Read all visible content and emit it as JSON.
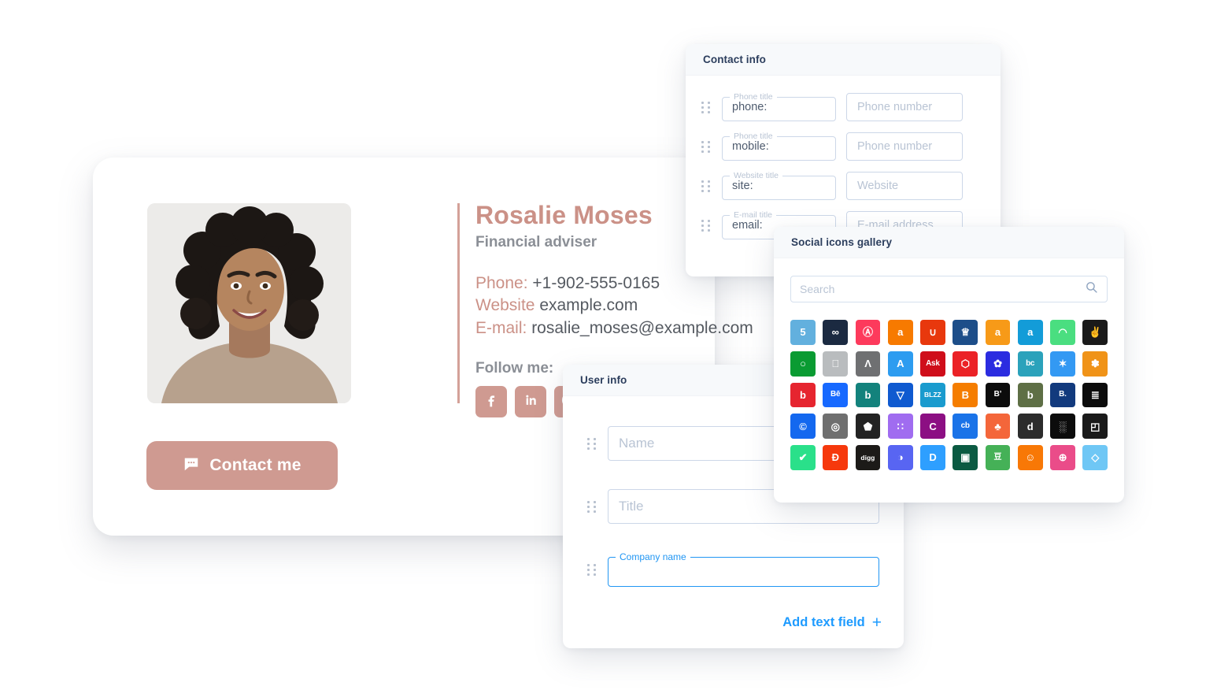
{
  "signature_card": {
    "name": "Rosalie Moses",
    "role": "Financial adviser",
    "contact_lines": [
      {
        "label": "Phone:",
        "value": "+1-902-555-0165"
      },
      {
        "label": "Website",
        "value": "example.com"
      },
      {
        "label": "E-mail:",
        "value": "rosalie_moses@example.com"
      }
    ],
    "follow_label": "Follow me:",
    "social_buttons": [
      {
        "name": "facebook-icon"
      },
      {
        "name": "linkedin-icon"
      },
      {
        "name": "messenger-icon"
      }
    ],
    "contact_button": {
      "label": "Contact me",
      "icon": "chat-bubble-icon"
    },
    "colors": {
      "accent": "#cb9187",
      "button": "#cf9a91",
      "role": "#8b8f96",
      "body_text": "#555a61"
    }
  },
  "contact_info_panel": {
    "title": "Contact info",
    "rows": [
      {
        "legend": "Phone title",
        "value": "phone:",
        "placeholder": "Phone number"
      },
      {
        "legend": "Phone title",
        "value": "mobile:",
        "placeholder": "Phone number"
      },
      {
        "legend": "Website title",
        "value": "site:",
        "placeholder": "Website"
      },
      {
        "legend": "E-mail title",
        "value": "email:",
        "placeholder": "E-mail address"
      }
    ]
  },
  "user_info_panel": {
    "title": "User info",
    "rows": [
      {
        "type": "placeholder",
        "placeholder": "Name",
        "legend": "",
        "value": ""
      },
      {
        "type": "placeholder",
        "placeholder": "Title",
        "legend": "",
        "value": ""
      },
      {
        "type": "outlined",
        "legend": "Company name",
        "value": "",
        "placeholder": "",
        "active": true
      }
    ],
    "add_field_label": "Add text field",
    "add_field_icon": "plus-icon",
    "colors": {
      "link": "#1e9bff"
    }
  },
  "gallery_panel": {
    "title": "Social icons gallery",
    "search": {
      "placeholder": "Search",
      "icon": "search-icon",
      "value": ""
    },
    "icons": [
      {
        "name": "500px-icon",
        "bg": "#62b0de",
        "glyph": "5",
        "style": "gt"
      },
      {
        "name": "8tracks-icon",
        "bg": "#1b2a41",
        "glyph": "∞",
        "style": "gt"
      },
      {
        "name": "airbnb-icon",
        "bg": "#fd3a5c",
        "glyph": "Ⓐ",
        "style": "gt"
      },
      {
        "name": "alibaba-icon",
        "bg": "#f77a00",
        "glyph": "a",
        "style": "gt"
      },
      {
        "name": "aliexpress-icon",
        "bg": "#e8380d",
        "glyph": "∪",
        "style": "gt"
      },
      {
        "name": "allrecipes-icon",
        "bg": "#1d4e89",
        "glyph": "♕",
        "style": "gt"
      },
      {
        "name": "amazon-icon",
        "bg": "#f79a18",
        "glyph": "a",
        "style": "gt"
      },
      {
        "name": "amazon-alt-icon",
        "bg": "#139cd8",
        "glyph": "a",
        "style": "gt"
      },
      {
        "name": "android-icon",
        "bg": "#4ade80",
        "glyph": "◠",
        "style": "gt"
      },
      {
        "name": "angellist-icon",
        "bg": "#1a1a1a",
        "glyph": "✌",
        "style": "gt"
      },
      {
        "name": "aim-icon",
        "bg": "#0a9b32",
        "glyph": "○",
        "style": "gt"
      },
      {
        "name": "apple-icon",
        "bg": "#b9bcbe",
        "glyph": "",
        "style": "gt"
      },
      {
        "name": "apple-music-icon",
        "bg": "#6f7072",
        "glyph": "Λ",
        "style": "gt"
      },
      {
        "name": "app-store-icon",
        "bg": "#2d9cf0",
        "glyph": "A",
        "style": "gt"
      },
      {
        "name": "ask-fm-icon",
        "bg": "#cf0e1a",
        "glyph": "Ask",
        "style": "gt sm"
      },
      {
        "name": "autodesk-icon",
        "bg": "#eb2226",
        "glyph": "⬡",
        "style": "gt"
      },
      {
        "name": "baidu-icon",
        "bg": "#2b2ce0",
        "glyph": "✿",
        "style": "gt"
      },
      {
        "name": "bandcamp-icon",
        "bg": "#2ba2bb",
        "glyph": "bc",
        "style": "gt sm"
      },
      {
        "name": "basecamp-icon",
        "bg": "#3399f3",
        "glyph": "✶",
        "style": "gt"
      },
      {
        "name": "beatport-icon",
        "bg": "#f09318",
        "glyph": "✽",
        "style": "gt"
      },
      {
        "name": "bebo-icon",
        "bg": "#e6252f",
        "glyph": "b",
        "style": "gt"
      },
      {
        "name": "behance-icon",
        "bg": "#1769ff",
        "glyph": "Bē",
        "style": "gt sm"
      },
      {
        "name": "bing-icon",
        "bg": "#13827c",
        "glyph": "b",
        "style": "gt"
      },
      {
        "name": "bitbucket-icon",
        "bg": "#0f5ad0",
        "glyph": "▽",
        "style": "gt"
      },
      {
        "name": "blizzard-icon",
        "bg": "#1a9bce",
        "glyph": "BLZZ",
        "style": "gt xs"
      },
      {
        "name": "blogger-icon",
        "bg": "#f57d00",
        "glyph": "B",
        "style": "gt"
      },
      {
        "name": "bloglovin-icon",
        "bg": "#0c0c0c",
        "glyph": "B’",
        "style": "gt sm"
      },
      {
        "name": "bookbub-icon",
        "bg": "#5e6f45",
        "glyph": "b",
        "style": "gt"
      },
      {
        "name": "booking-icon",
        "bg": "#123a7d",
        "glyph": "B.",
        "style": "gt sm"
      },
      {
        "name": "buffer-icon",
        "bg": "#0c0c0c",
        "glyph": "≣",
        "style": "gt"
      },
      {
        "name": "cc-icon",
        "bg": "#1468ef",
        "glyph": "©",
        "style": "gt"
      },
      {
        "name": "chrome-icon",
        "bg": "#6f6f6f",
        "glyph": "◎",
        "style": "gt"
      },
      {
        "name": "codepen-icon",
        "bg": "#232323",
        "glyph": "⬟",
        "style": "gt"
      },
      {
        "name": "coderwall-icon",
        "bg": "#a06cf0",
        "glyph": "∷",
        "style": "gt"
      },
      {
        "name": "cratejoy-icon",
        "bg": "#8c0f83",
        "glyph": "C",
        "style": "gt"
      },
      {
        "name": "crunchbase-icon",
        "bg": "#1a73e8",
        "glyph": "cb",
        "style": "gt sm"
      },
      {
        "name": "crunchyroll-icon",
        "bg": "#f4663a",
        "glyph": "♣",
        "style": "gt"
      },
      {
        "name": "dailymotion-icon",
        "bg": "#2c2c2c",
        "glyph": "d",
        "style": "gt"
      },
      {
        "name": "deezer-icon",
        "bg": "#0c0c0c",
        "glyph": "░",
        "style": "gt"
      },
      {
        "name": "delicious-icon",
        "bg": "#1a1a1a",
        "glyph": "◰",
        "style": "gt"
      },
      {
        "name": "deviantart-icon",
        "bg": "#2ae08a",
        "glyph": "✔",
        "style": "gt"
      },
      {
        "name": "dfinity-icon",
        "bg": "#f6380c",
        "glyph": "Đ",
        "style": "gt"
      },
      {
        "name": "digg-icon",
        "bg": "#1c1a18",
        "glyph": "digg",
        "style": "gt xs"
      },
      {
        "name": "discord-icon",
        "bg": "#5865f2",
        "glyph": "◑",
        "style": "gt"
      },
      {
        "name": "disqus-icon",
        "bg": "#2e9fff",
        "glyph": "D",
        "style": "gt"
      },
      {
        "name": "dooma-icon",
        "bg": "#0b5a42",
        "glyph": "▣",
        "style": "gt"
      },
      {
        "name": "douban-icon",
        "bg": "#45b157",
        "glyph": "豆",
        "style": "gt sm"
      },
      {
        "name": "draugiem-icon",
        "bg": "#f87806",
        "glyph": "☺",
        "style": "gt"
      },
      {
        "name": "dribbble-icon",
        "bg": "#ea4c89",
        "glyph": "⊕",
        "style": "gt"
      },
      {
        "name": "drupal-icon",
        "bg": "#6fc7f5",
        "glyph": "◇",
        "style": "gt"
      }
    ]
  }
}
